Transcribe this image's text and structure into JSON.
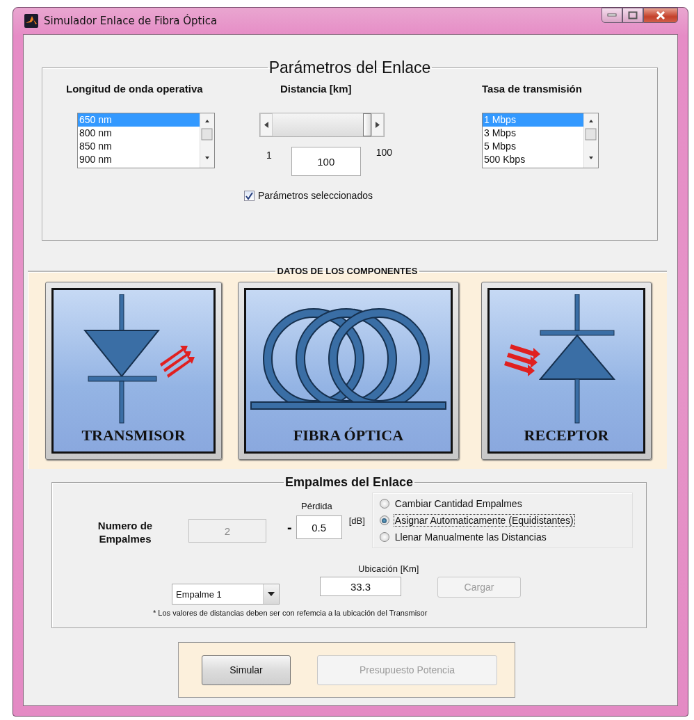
{
  "window": {
    "title": "Simulador Enlace de Fibra Óptica"
  },
  "parameters": {
    "title": "Parámetros del Enlace",
    "wavelength": {
      "label": "Longitud de onda operativa",
      "options": [
        {
          "label": "650 nm",
          "selected": true
        },
        {
          "label": "800 nm",
          "selected": false
        },
        {
          "label": "850 nm",
          "selected": false
        },
        {
          "label": "900 nm",
          "selected": false
        }
      ]
    },
    "distance": {
      "label": "Distancia [km]",
      "level": 1,
      "min": "1",
      "max": "100",
      "value": "100"
    },
    "rate": {
      "label": "Tasa de transmisión",
      "options": [
        {
          "label": "1 Mbps",
          "selected": true
        },
        {
          "label": "3 Mbps",
          "selected": false
        },
        {
          "label": "5 Mbps",
          "selected": false
        },
        {
          "label": "500 Kbps",
          "selected": false
        }
      ]
    },
    "confirm": {
      "label": "Parámetros seleccionados",
      "checked": true
    }
  },
  "components": {
    "title": "DATOS DE LOS COMPONENTES",
    "cards": [
      {
        "kind": "transmitter",
        "label": "TRANSMISOR"
      },
      {
        "kind": "fiber",
        "label": "FIBRA ÓPTICA"
      },
      {
        "kind": "receiver",
        "label": "RECEPTOR"
      }
    ]
  },
  "splices": {
    "title": "Empalmes del Enlace",
    "count_label": "Numero de Empalmes",
    "count": {
      "value": "2",
      "disabled": true
    },
    "loss_label": "Pérdida",
    "dash": "-",
    "loss": "0.5",
    "loss_unit": "[dB]",
    "modes": [
      {
        "label": "Cambiar Cantidad Empalmes",
        "selected": false
      },
      {
        "label": "Asignar Automaticamente (Equidistantes)",
        "selected": true
      },
      {
        "label": "Llenar Manualmente las Distancias",
        "selected": false
      }
    ],
    "location_label": "Ubicación [Km]",
    "splice_select": "Empalme 1",
    "location": "33.3",
    "load": {
      "label": "Cargar",
      "disabled": true
    },
    "note": "* Los valores de distancias deben ser con refemcia a la ubicación del Transmisor"
  },
  "actions": [
    {
      "label": "Simular",
      "disabled": false
    },
    {
      "label": "Presupuesto Potencia",
      "disabled": true
    }
  ]
}
